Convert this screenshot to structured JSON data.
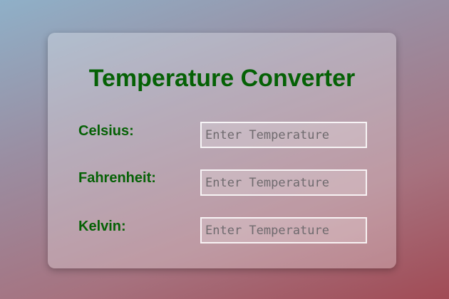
{
  "converter": {
    "title": "Temperature Converter",
    "fields": [
      {
        "label": "Celsius:",
        "value": "",
        "placeholder": "Enter Temperature"
      },
      {
        "label": "Fahrenheit:",
        "value": "",
        "placeholder": "Enter Temperature"
      },
      {
        "label": "Kelvin:",
        "value": "",
        "placeholder": "Enter Temperature"
      }
    ]
  },
  "colors": {
    "title_green": "#056105",
    "label_green": "#056105"
  }
}
